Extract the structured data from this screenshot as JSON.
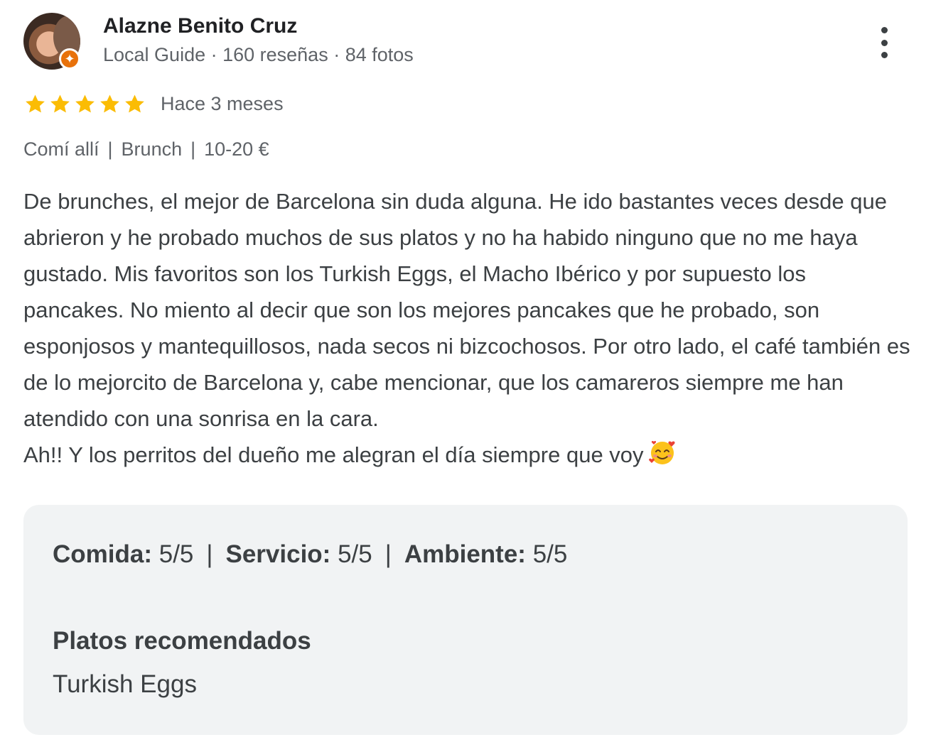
{
  "author": {
    "name": "Alazne Benito Cruz",
    "meta": "Local Guide · 160 reseñas · 84 fotos",
    "badge_icon": "local-guide-badge-icon",
    "menu_icon": "more-vert-icon"
  },
  "rating": {
    "stars": 5,
    "max": 5,
    "star_color": "#fbbc04",
    "date": "Hace 3 meses"
  },
  "attributes": [
    "Comí allí",
    "Brunch",
    "10-20 €"
  ],
  "review": {
    "paragraphs": [
      "De brunches, el mejor de Barcelona sin duda alguna. He ido bastantes veces desde que abrieron y he probado muchos de sus platos y no ha habido ninguno que no me haya gustado. Mis favoritos son los Turkish Eggs, el Macho Ibérico y por supuesto los pancakes. No miento al decir que son los mejores pancakes que he probado, son esponjosos y mantequillosos, nada secos ni bizcochosos. Por otro lado, el café también es de lo mejorcito de Barcelona y, cabe mencionar, que los camareros siempre me han atendido con una sonrisa en la cara.",
      "Ah!! Y los perritos del dueño me alegran el día siempre que voy"
    ],
    "emoji_icon": "smiling-face-with-hearts-icon"
  },
  "sub_ratings": [
    {
      "label": "Comida:",
      "value": "5/5"
    },
    {
      "label": "Servicio:",
      "value": "5/5"
    },
    {
      "label": "Ambiente:",
      "value": "5/5"
    }
  ],
  "recommended": {
    "title": "Platos recomendados",
    "value": "Turkish Eggs"
  }
}
